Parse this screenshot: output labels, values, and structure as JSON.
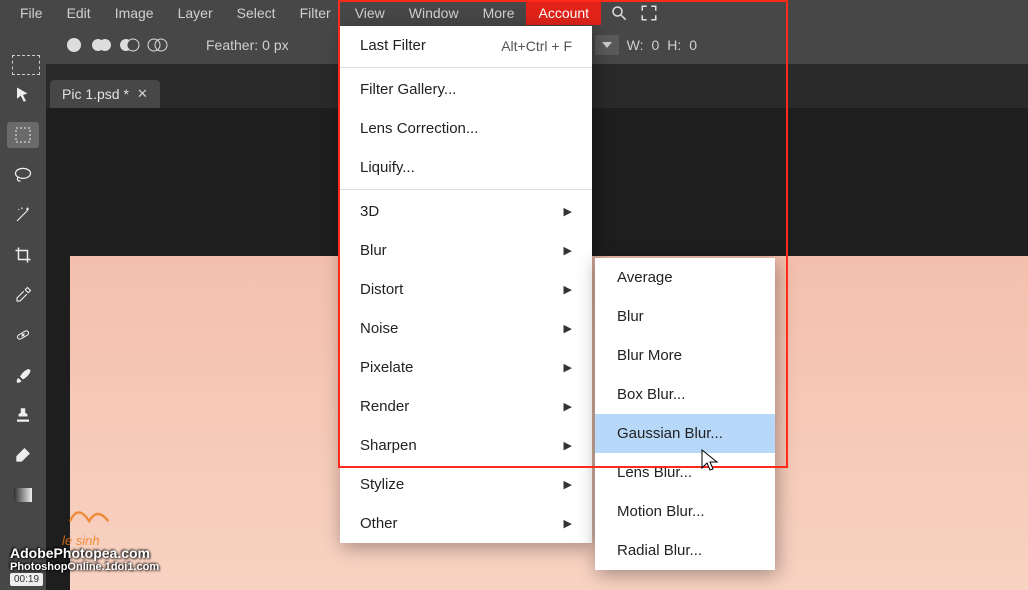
{
  "menubar": {
    "items": [
      "File",
      "Edit",
      "Image",
      "Layer",
      "Select",
      "Filter",
      "View",
      "Window",
      "More"
    ],
    "account": "Account"
  },
  "options": {
    "feather_label": "Feather:",
    "feather_value": "0 px",
    "w_label": "W:",
    "w_value": "0",
    "h_label": "H:",
    "h_value": "0"
  },
  "tab": {
    "title": "Pic 1.psd *"
  },
  "filter_menu": {
    "last_filter": "Last Filter",
    "last_filter_shortcut": "Alt+Ctrl + F",
    "filter_gallery": "Filter Gallery...",
    "lens_correction": "Lens Correction...",
    "liquify": "Liquify...",
    "three_d": "3D",
    "blur": "Blur",
    "distort": "Distort",
    "noise": "Noise",
    "pixelate": "Pixelate",
    "render": "Render",
    "sharpen": "Sharpen",
    "stylize": "Stylize",
    "other": "Other"
  },
  "blur_submenu": {
    "average": "Average",
    "blur": "Blur",
    "blur_more": "Blur More",
    "box_blur": "Box Blur...",
    "gaussian_blur": "Gaussian Blur...",
    "lens_blur": "Lens Blur...",
    "motion_blur": "Motion Blur...",
    "radial_blur": "Radial Blur..."
  },
  "watermark": {
    "brand": "le sinh",
    "site1": "AdobePhotopea.com",
    "site2": "PhotoshopOnline.1doi1.com"
  },
  "timestamp": "00:19",
  "tickmarks": "≺≺"
}
